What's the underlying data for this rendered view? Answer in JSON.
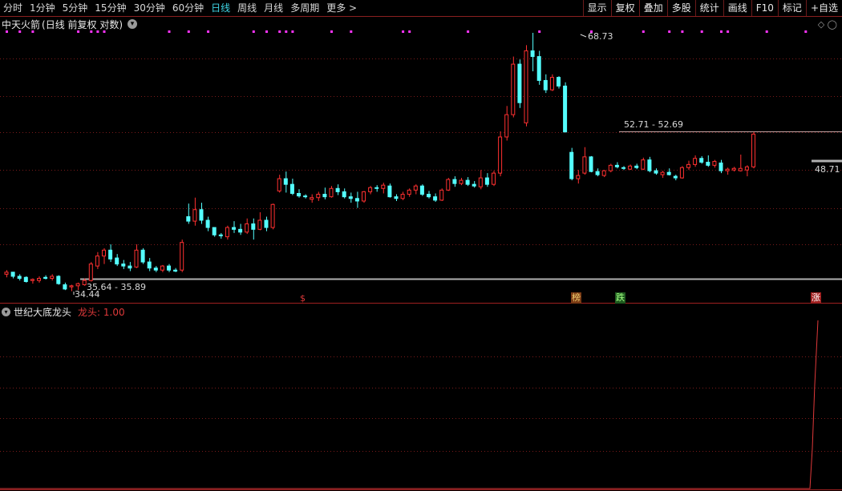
{
  "toolbar": {
    "periods": [
      "分时",
      "1分钟",
      "5分钟",
      "15分钟",
      "30分钟",
      "60分钟",
      "日线",
      "周线",
      "月线",
      "多周期",
      "更多 >"
    ],
    "active_period": "日线",
    "buttons": [
      "显示",
      "复权",
      "叠加",
      "多股",
      "统计",
      "画线",
      "F10",
      "标记",
      "+自选"
    ]
  },
  "main_chart": {
    "stock_name": "中天火箭",
    "mode": "(日线 前复权 对数)",
    "corner_icons": "◇ ◯",
    "high_label": "68.73",
    "low_label": "34.44",
    "zone_low_label": "35.64 - 35.89",
    "zone_high_label": "52.71 - 52.69",
    "last_price_label": "48.71",
    "colors": {
      "up": "#ff3030",
      "down": "#54ffff",
      "grid": "#7a1a1a",
      "dots": "#ff33ff",
      "line": "#b0b0b0"
    }
  },
  "markers": {
    "dollar": "$",
    "bang": "榜",
    "die": "跌",
    "zhang": "涨"
  },
  "sub_chart": {
    "name": "世纪大底龙头",
    "indicator": "龙头: 1.00",
    "color": "#e0393a"
  },
  "chart_data": {
    "type": "candlestick",
    "scale": "log",
    "candles": [
      [
        36.0,
        36.4,
        35.7,
        36.2
      ],
      [
        36.2,
        36.1,
        35.6,
        35.8
      ],
      [
        35.8,
        36.0,
        35.4,
        35.6
      ],
      [
        35.7,
        35.8,
        35.2,
        35.3
      ],
      [
        35.4,
        35.6,
        35.1,
        35.5
      ],
      [
        35.4,
        35.8,
        35.2,
        35.6
      ],
      [
        35.7,
        35.9,
        35.5,
        35.6
      ],
      [
        35.6,
        36.0,
        35.4,
        35.8
      ],
      [
        35.8,
        35.9,
        35.0,
        35.1
      ],
      [
        35.0,
        35.2,
        34.5,
        34.6
      ],
      [
        34.8,
        35.0,
        34.4,
        34.9
      ],
      [
        34.9,
        35.2,
        34.5,
        35.1
      ],
      [
        35.0,
        35.6,
        34.9,
        35.4
      ],
      [
        35.4,
        37.2,
        35.3,
        37.0
      ],
      [
        36.8,
        38.2,
        36.5,
        37.8
      ],
      [
        37.8,
        38.6,
        37.0,
        38.4
      ],
      [
        38.4,
        39.0,
        37.2,
        37.5
      ],
      [
        37.6,
        38.0,
        36.8,
        37.0
      ],
      [
        37.0,
        37.4,
        36.5,
        36.8
      ],
      [
        36.8,
        37.2,
        36.3,
        36.6
      ],
      [
        36.7,
        39.0,
        36.6,
        38.4
      ],
      [
        38.4,
        38.6,
        37.0,
        37.2
      ],
      [
        37.2,
        37.6,
        36.3,
        36.6
      ],
      [
        36.6,
        36.8,
        36.2,
        36.4
      ],
      [
        36.4,
        36.9,
        36.2,
        36.8
      ],
      [
        36.8,
        37.0,
        36.2,
        36.4
      ],
      [
        36.4,
        36.6,
        36.2,
        36.3
      ],
      [
        36.4,
        39.5,
        36.2,
        39.2
      ],
      [
        42.0,
        43.5,
        41.2,
        41.5
      ],
      [
        41.5,
        44.2,
        41.0,
        42.8
      ],
      [
        42.8,
        43.6,
        41.2,
        41.6
      ],
      [
        41.6,
        42.0,
        40.4,
        40.8
      ],
      [
        40.8,
        40.8,
        39.8,
        40.0
      ],
      [
        40.0,
        40.2,
        39.6,
        39.9
      ],
      [
        39.8,
        41.0,
        39.5,
        40.8
      ],
      [
        40.8,
        41.5,
        40.2,
        40.6
      ],
      [
        40.6,
        41.2,
        40.0,
        40.3
      ],
      [
        40.3,
        41.8,
        40.1,
        41.2
      ],
      [
        41.2,
        41.8,
        39.5,
        40.6
      ],
      [
        40.6,
        42.5,
        40.5,
        41.6
      ],
      [
        41.6,
        42.0,
        40.4,
        40.8
      ],
      [
        40.8,
        43.5,
        40.6,
        43.4
      ],
      [
        45.0,
        47.0,
        44.8,
        46.5
      ],
      [
        46.5,
        47.4,
        44.8,
        45.8
      ],
      [
        45.8,
        46.5,
        44.5,
        44.7
      ],
      [
        44.7,
        45.2,
        44.2,
        44.4
      ],
      [
        44.4,
        44.6,
        44.1,
        44.3
      ],
      [
        44.0,
        44.6,
        43.6,
        44.2
      ],
      [
        44.2,
        44.9,
        43.8,
        44.6
      ],
      [
        44.6,
        45.4,
        44.0,
        44.3
      ],
      [
        44.3,
        45.6,
        44.2,
        45.3
      ],
      [
        45.3,
        45.8,
        44.5,
        44.9
      ],
      [
        44.9,
        45.3,
        44.1,
        44.3
      ],
      [
        44.3,
        44.8,
        43.6,
        44.1
      ],
      [
        44.1,
        44.9,
        43.0,
        43.8
      ],
      [
        43.8,
        45.0,
        43.6,
        44.9
      ],
      [
        44.9,
        45.6,
        44.6,
        45.4
      ],
      [
        45.4,
        45.7,
        44.9,
        45.3
      ],
      [
        45.3,
        46.0,
        44.7,
        45.7
      ],
      [
        45.6,
        45.9,
        44.2,
        44.3
      ],
      [
        44.3,
        44.6,
        43.8,
        44.1
      ],
      [
        44.1,
        44.9,
        43.9,
        44.6
      ],
      [
        44.6,
        45.3,
        44.3,
        45.1
      ],
      [
        45.1,
        45.8,
        44.6,
        45.6
      ],
      [
        45.6,
        45.8,
        44.4,
        44.6
      ],
      [
        44.6,
        45.0,
        44.1,
        44.3
      ],
      [
        44.3,
        44.7,
        43.7,
        43.9
      ],
      [
        43.9,
        45.3,
        43.8,
        45.1
      ],
      [
        45.1,
        46.6,
        45.0,
        46.4
      ],
      [
        46.4,
        46.8,
        45.5,
        45.9
      ],
      [
        45.9,
        46.6,
        45.7,
        46.3
      ],
      [
        46.3,
        46.7,
        45.6,
        45.8
      ],
      [
        45.8,
        46.2,
        45.4,
        45.6
      ],
      [
        45.5,
        47.6,
        45.2,
        46.6
      ],
      [
        46.6,
        47.2,
        45.5,
        45.8
      ],
      [
        45.8,
        47.5,
        45.6,
        47.2
      ],
      [
        47.2,
        52.8,
        46.8,
        52.0
      ],
      [
        52.0,
        56.5,
        51.5,
        55.2
      ],
      [
        55.2,
        64.5,
        54.8,
        63.2
      ],
      [
        63.2,
        64.0,
        56.2,
        57.0
      ],
      [
        54.0,
        66.5,
        53.5,
        65.5
      ],
      [
        65.5,
        68.73,
        62.0,
        64.5
      ],
      [
        64.5,
        65.5,
        59.8,
        60.5
      ],
      [
        60.5,
        61.5,
        58.5,
        59.0
      ],
      [
        59.0,
        61.5,
        58.8,
        61.0
      ],
      [
        61.0,
        61.2,
        59.2,
        59.6
      ],
      [
        59.6,
        60.2,
        52.8,
        52.7
      ],
      [
        49.9,
        50.5,
        46.3,
        46.5
      ],
      [
        46.5,
        47.6,
        45.9,
        46.9
      ],
      [
        47.2,
        50.6,
        47.0,
        49.3
      ],
      [
        49.3,
        49.4,
        47.3,
        47.4
      ],
      [
        47.4,
        47.8,
        46.8,
        47.0
      ],
      [
        46.9,
        47.6,
        46.7,
        47.5
      ],
      [
        47.5,
        48.4,
        47.3,
        48.2
      ],
      [
        48.2,
        48.6,
        47.8,
        48.0
      ],
      [
        47.9,
        48.1,
        47.6,
        47.8
      ],
      [
        47.7,
        48.3,
        47.6,
        48.1
      ],
      [
        48.1,
        48.4,
        47.7,
        47.9
      ],
      [
        47.7,
        49.2,
        47.6,
        48.9
      ],
      [
        48.9,
        49.3,
        47.3,
        47.5
      ],
      [
        47.5,
        47.8,
        47.0,
        47.2
      ],
      [
        47.0,
        47.5,
        46.6,
        47.3
      ],
      [
        47.3,
        47.8,
        46.9,
        47.0
      ],
      [
        46.8,
        47.0,
        46.3,
        46.6
      ],
      [
        46.6,
        48.1,
        46.5,
        47.9
      ],
      [
        47.9,
        48.8,
        47.6,
        48.3
      ],
      [
        48.3,
        49.5,
        48.0,
        49.1
      ],
      [
        49.1,
        49.4,
        48.4,
        48.6
      ],
      [
        48.6,
        49.5,
        48.0,
        48.2
      ],
      [
        48.2,
        48.9,
        47.9,
        48.7
      ],
      [
        48.5,
        48.9,
        47.2,
        47.5
      ],
      [
        47.5,
        47.9,
        47.0,
        47.7
      ],
      [
        47.6,
        48.0,
        47.4,
        47.8
      ],
      [
        47.5,
        49.6,
        47.4,
        47.8
      ],
      [
        47.6,
        48.2,
        46.8,
        48.0
      ],
      [
        48.0,
        52.7,
        47.8,
        52.4
      ]
    ],
    "dot_row": [
      1,
      0,
      1,
      0,
      1,
      0,
      0,
      0,
      0,
      0,
      0,
      1,
      0,
      1,
      1,
      1,
      0,
      0,
      0,
      0,
      0,
      0,
      0,
      0,
      0,
      1,
      0,
      0,
      1,
      0,
      0,
      1,
      0,
      0,
      0,
      0,
      0,
      0,
      1,
      0,
      1,
      0,
      1,
      1,
      1,
      0,
      0,
      0,
      0,
      0,
      1,
      0,
      0,
      1,
      0,
      0,
      0,
      0,
      0,
      0,
      0,
      1,
      1,
      0,
      0,
      0,
      0,
      0,
      0,
      0,
      0,
      1,
      0,
      0,
      0,
      0,
      0,
      0,
      0,
      0,
      0,
      0,
      1,
      0,
      0,
      0,
      0,
      0,
      0,
      0,
      1,
      0,
      0,
      0,
      0,
      0,
      0,
      0,
      1,
      0,
      0,
      0,
      1,
      0,
      1,
      0,
      0,
      1,
      0,
      0,
      1,
      1,
      0,
      0,
      0,
      0,
      0,
      1,
      0,
      0,
      0,
      0,
      0,
      1,
      0
    ],
    "zone_low": 35.7,
    "zone_high": 52.7,
    "last_price": 48.71
  }
}
